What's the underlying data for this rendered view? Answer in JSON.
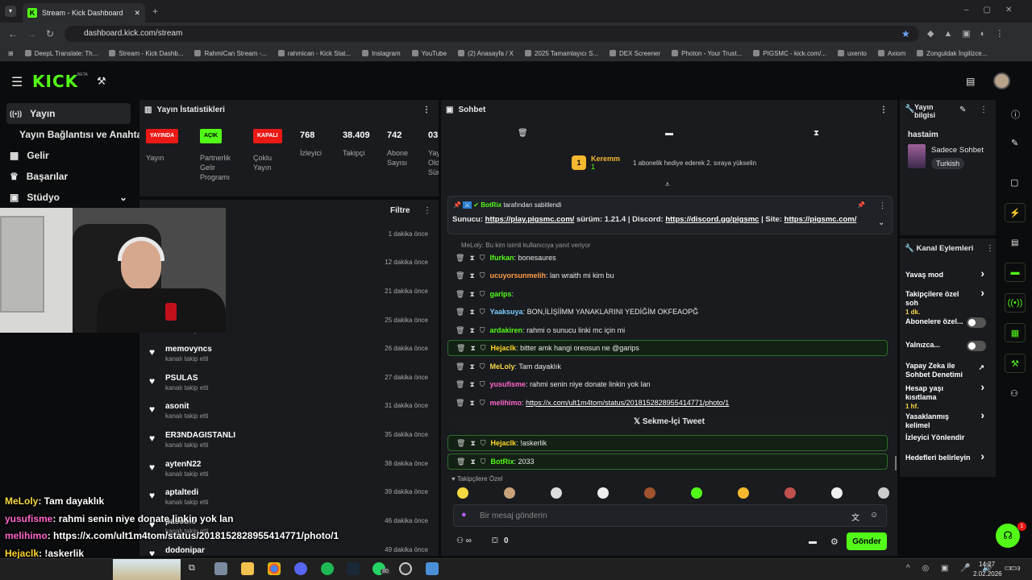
{
  "browser": {
    "tab_title": "Stream - Kick Dashboard",
    "url": "dashboard.kick.com/stream",
    "bookmarks": [
      "DeepL Translate: Th...",
      "Stream - Kick Dashb...",
      "RahmiCan Stream -...",
      "rahmican - Kick Stat...",
      "Instagram",
      "YouTube",
      "(2) Anasayfa / X",
      "2025 Tamamlayıcı S...",
      "DEX Screener",
      "Photon - Your Trust...",
      "PIGSMC - kick.com/...",
      "uxento",
      "Axiom",
      "Zonguldak İngilizce..."
    ]
  },
  "brand": {
    "logo": "KICK",
    "beta": "BETA",
    "accent": "#53fc18"
  },
  "sidebar": {
    "items": [
      {
        "label": "Yayın",
        "icon": "broadcast-icon"
      },
      {
        "label": "Yayın Bağlantısı ve Anahtarı"
      },
      {
        "label": "Gelir",
        "icon": "wallet-icon"
      },
      {
        "label": "Başarılar",
        "icon": "trophy-icon"
      },
      {
        "label": "Stüdyo",
        "icon": "studio-icon"
      }
    ]
  },
  "stats": {
    "title": "Yayın İstatistikleri",
    "cols": [
      {
        "badge": "YAYINDA",
        "label": "Yayın",
        "color": "#e91916"
      },
      {
        "badge": "AÇIK",
        "label": "Partnerlik Gelir Programı",
        "color": "#53fc18"
      },
      {
        "badge": "KAPALI",
        "label": "Çoklu Yayın",
        "color": "#e91916"
      },
      {
        "value": "768",
        "label": "İzleyici"
      },
      {
        "value": "38.409",
        "label": "Takipçi"
      },
      {
        "value": "742",
        "label": "Abone Sayısı"
      },
      {
        "value": "03:",
        "label": "Yay Old Sür"
      }
    ]
  },
  "activity": {
    "filter": "Filtre",
    "rows": [
      {
        "name": "",
        "sub": "",
        "time": "1 dakika önce"
      },
      {
        "name": "",
        "sub": "",
        "time": "12 dakika önce"
      },
      {
        "name": "",
        "sub": "",
        "time": "21 dakika önce"
      },
      {
        "name": "",
        "sub": "kanalı takip etti",
        "time": "25 dakika önce"
      },
      {
        "name": "memovyncs",
        "sub": "kanalı takip etti",
        "time": "26 dakika önce"
      },
      {
        "name": "PSULAS",
        "sub": "kanalı takip etti",
        "time": "27 dakika önce"
      },
      {
        "name": "asonit",
        "sub": "kanalı takip etti",
        "time": "31 dakika önce"
      },
      {
        "name": "ER3NDAGISTANLI",
        "sub": "kanalı takip etti",
        "time": "35 dakika önce"
      },
      {
        "name": "aytenN22",
        "sub": "kanalı takip etti",
        "time": "38 dakika önce"
      },
      {
        "name": "aptaltedi",
        "sub": "kanalı takip etti",
        "time": "39 dakika önce"
      },
      {
        "name": "pasoblo",
        "sub": "kanalı takip etti",
        "time": "46 dakika önce"
      },
      {
        "name": "dodonipar",
        "sub": "",
        "time": "49 dakika önce"
      }
    ]
  },
  "overlay_chat": [
    {
      "user": "MeLoly",
      "text": ": Tam dayaklık",
      "color": "#f5d742"
    },
    {
      "user": "yusufisme",
      "text": ": rahmi senin niye donate linkin yok lan",
      "color": "#ff66cc"
    },
    {
      "user": "melihimo",
      "text": ": https://x.com/ult1m4tom/status/2018152828955414771/photo/1",
      "color": "#ff66cc"
    },
    {
      "user": "Hejaclk",
      "text": ": !askerlik",
      "color": "#ffd42a"
    },
    {
      "user": "BotRix",
      "text": ": 2033",
      "color": "#53fc18"
    }
  ],
  "chat": {
    "title": "Sohbet",
    "gift": {
      "rank": "1",
      "user": "Keremm",
      "count": "1",
      "text": "1 abonelik hediye ederek 2. sıraya yükselin"
    },
    "pinned": {
      "by": "BotRix",
      "by_suffix": "tarafından sabitlendi",
      "prefix": "Sunucu:",
      "link1": "https://play.pigsmc.com/",
      "mid1": "sürüm: 1.21.4 | Discord:",
      "link2": "https://discord.gg/pigsmc",
      "mid2": "| Site:",
      "link3": "https://pigsmc.com/"
    },
    "reply_hint": "MeLoly: Bu kim isimli kullanıcıya yanıt veriyor",
    "messages": [
      {
        "user": "Ifurkan",
        "text": ": bonesaures",
        "color": "#53fc18"
      },
      {
        "user": "ucuyorsunmelih",
        "text": ": lan wraith mi kim bu",
        "color": "#ff9b45"
      },
      {
        "user": "garips",
        "text": ":",
        "color": "#53fc18"
      },
      {
        "user": "Yaaksuya",
        "text": ": BON,İLİŞİİMM YANAKLARINI YEDİĞİM OKFEAOPĞ",
        "color": "#7ec8ff"
      },
      {
        "user": "ardakiren",
        "text": ": rahmi o sunucu linki mc için mi",
        "color": "#53fc18"
      },
      {
        "user": "Hejaclk",
        "text": ": bitter amk hangi oreosun ne @garips",
        "color": "#ffd42a"
      },
      {
        "user": "MeLoly",
        "text": ": Tam dayaklık",
        "color": "#f5d742"
      },
      {
        "user": "yusufisme",
        "text": ": rahmi senin niye donate linkin yok lan",
        "color": "#ff66cc"
      },
      {
        "user": "melihimo",
        "text": ":",
        "link": "https://x.com/ult1m4tom/status/2018152828955414771/photo/1",
        "color": "#ff66cc"
      }
    ],
    "tweet_label": "Sekme-İçi Tweet",
    "after": [
      {
        "user": "Hejaclk",
        "text": ": !askerlik",
        "color": "#ffd42a"
      },
      {
        "user": "BotRix",
        "text": ": 2033",
        "color": "#53fc18"
      }
    ],
    "emote_section": "Takipçilere Özel",
    "input_placeholder": "Bir mesaj gönderin",
    "count": "0",
    "send": "Gönder"
  },
  "stream_info": {
    "title": "Yayın bilgisi",
    "stream_title": "hastaim",
    "category": "Sadece Sohbet",
    "language": "Turkish"
  },
  "channel_actions": {
    "title": "Kanal Eylemleri",
    "items": [
      {
        "label": "Yavaş mod",
        "sub": ""
      },
      {
        "label": "Takipçilere özel soh",
        "sub": "1 dk."
      },
      {
        "label": "Abonelere özel...",
        "sub": ""
      },
      {
        "label": "Yalnızca...",
        "sub": ""
      },
      {
        "label": "Yapay Zeka ile Sohbet Denetimi",
        "sub": ""
      },
      {
        "label": "Hesap yaşı kısıtlama",
        "sub": "1 hf."
      },
      {
        "label": "Yasaklanmış kelimel",
        "sub": ""
      },
      {
        "label": "İzleyici Yönlendir",
        "sub": ""
      },
      {
        "label": "Hedefleri belirleyin",
        "sub": ""
      }
    ]
  },
  "taskbar": {
    "time": "14:27",
    "date": "2.02.2026",
    "whatsapp_badge": "80",
    "notif": "3",
    "help_badge": "1"
  }
}
